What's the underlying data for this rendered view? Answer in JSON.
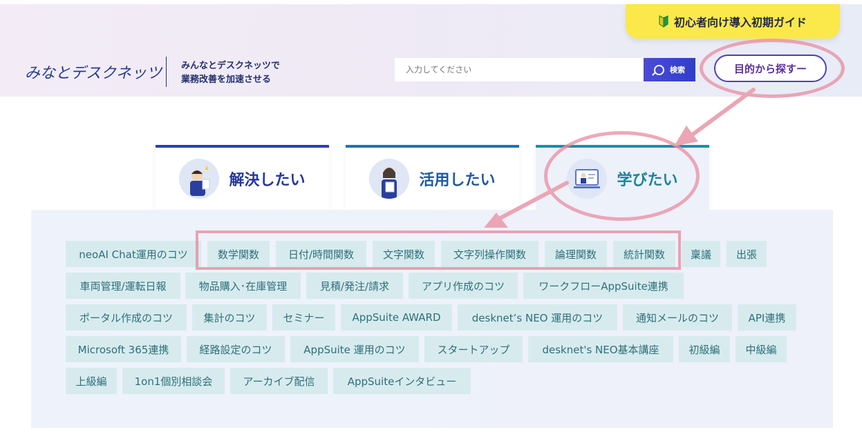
{
  "header": {
    "logo_text": "みなとデスクネッツ",
    "tagline_line1": "みんなとデスクネッツで",
    "tagline_line2": "業務改善を加速させる",
    "search": {
      "placeholder": "入力してください",
      "button_label": "検索"
    },
    "guide_banner_label": "初心者向け導入初期ガイド",
    "purpose_button_label": "目的から探すー"
  },
  "tabs": [
    {
      "label": "解決したい",
      "icon": "person-idea-icon"
    },
    {
      "label": "活用したい",
      "icon": "person-document-icon"
    },
    {
      "label": "学びたい",
      "icon": "online-lecture-icon",
      "active": true
    }
  ],
  "tags": [
    "neoAI Chat運用のコツ",
    "数学関数",
    "日付/時間関数",
    "文字関数",
    "文字列操作関数",
    "論理関数",
    "統計関数",
    "稟議",
    "出張",
    "車両管理/運転日報",
    "物品購入･在庫管理",
    "見積/発注/請求",
    "アプリ作成のコツ",
    "ワークフローAppSuite連携",
    "ポータル作成のコツ",
    "集計のコツ",
    "セミナー",
    "AppSuite AWARD",
    "desknet’s NEO 運用のコツ",
    "通知メールのコツ",
    "API連携",
    "Microsoft 365連携",
    "経路設定のコツ",
    "AppSuite 運用のコツ",
    "スタートアップ",
    "desknet's NEO基本講座",
    "初級編",
    "中級編",
    "上級編",
    "1on1個別相談会",
    "アーカイブ配信",
    "AppSuiteインタビュー"
  ],
  "colors": {
    "accent": "#2b3fb3",
    "banner_yellow": "#fbe84a",
    "tag_bg": "#d7ebee",
    "tag_text": "#2e6f7a",
    "annotation_pink": "#e88ca0"
  }
}
